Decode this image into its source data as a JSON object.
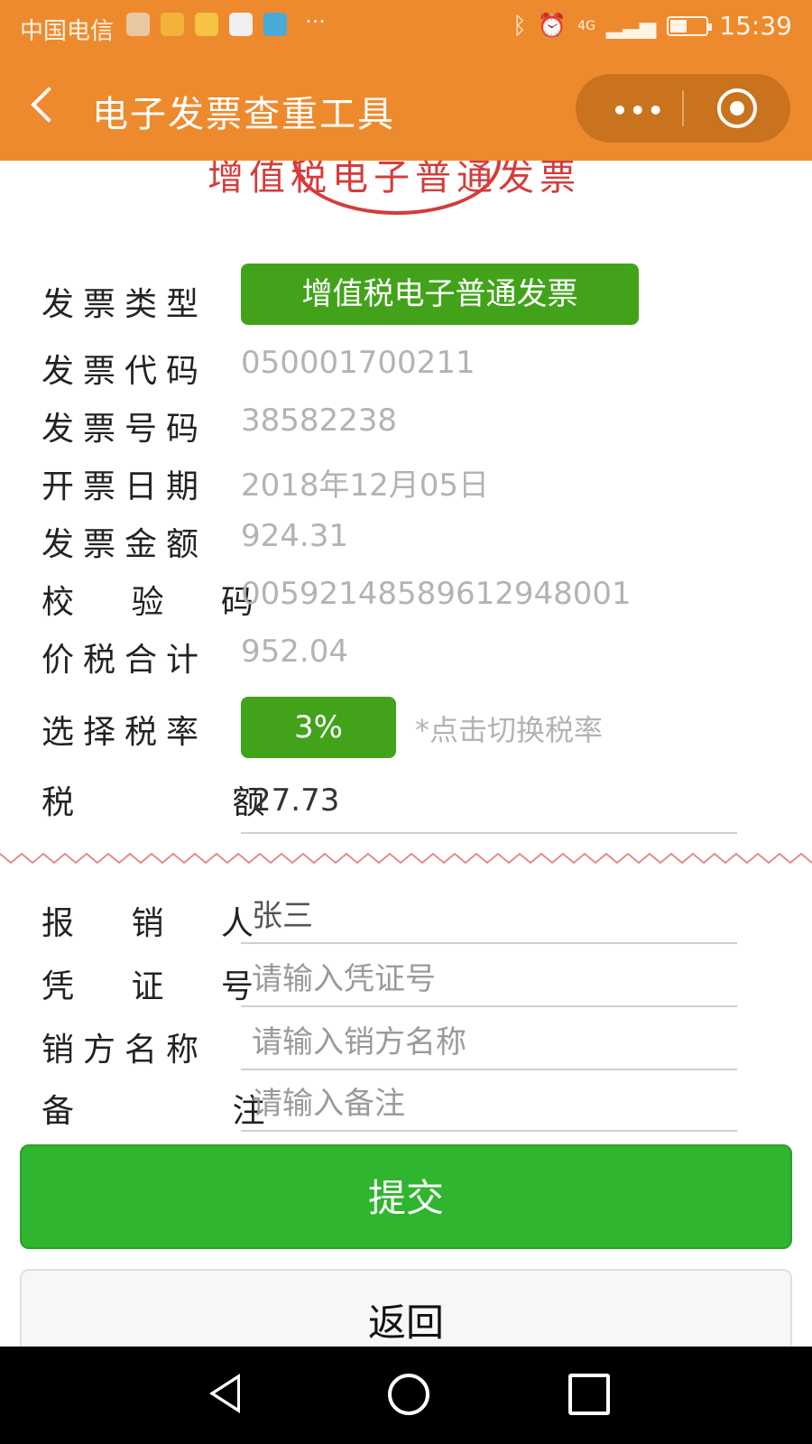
{
  "status_bar": {
    "carrier": "中国电信",
    "time": "15:39",
    "network": "4G",
    "more_dots": "···"
  },
  "nav": {
    "title": "电子发票查重工具",
    "more_dots": "•••"
  },
  "invoice_banner": {
    "title_text": "增值税电子普通发票"
  },
  "fields": {
    "invoice_type": {
      "label": "发票类型",
      "value": "增值税电子普通发票"
    },
    "invoice_code": {
      "label": "发票代码",
      "value": "050001700211"
    },
    "invoice_number": {
      "label": "发票号码",
      "value": "38582238"
    },
    "issue_date": {
      "label": "开票日期",
      "value": "2018年12月05日"
    },
    "amount": {
      "label": "发票金额",
      "value": "924.31"
    },
    "check_code": {
      "label": "校 验 码",
      "value": "00592148589612948001"
    },
    "total": {
      "label": "价税合计",
      "value": "952.04"
    },
    "tax_rate": {
      "label": "选择税率",
      "value": "3%",
      "hint": "*点击切换税率"
    },
    "tax_amount": {
      "label": "税 额",
      "value": "27.73"
    }
  },
  "form": {
    "claimant": {
      "label": "报 销 人",
      "value": "张三"
    },
    "voucher_no": {
      "label": "凭 证 号",
      "placeholder": "请输入凭证号"
    },
    "seller_name": {
      "label": "销方名称",
      "placeholder": "请输入销方名称"
    },
    "remark": {
      "label": "备 注",
      "placeholder": "请输入备注"
    }
  },
  "buttons": {
    "submit": "提交",
    "return": "返回"
  },
  "colors": {
    "header_orange": "#ee8a2e",
    "primary_green": "#2fb52f",
    "pill_green": "#42a31b",
    "seal_red": "#d43c3c"
  }
}
